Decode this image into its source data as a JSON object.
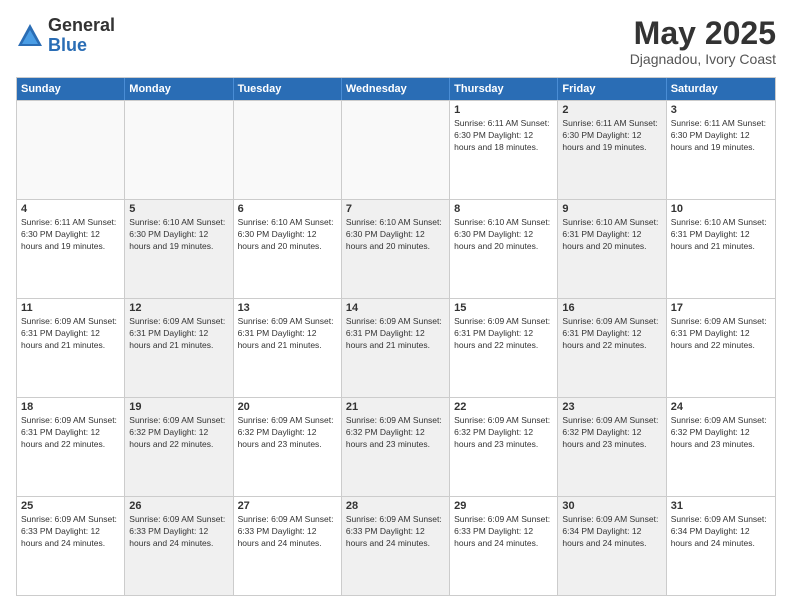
{
  "logo": {
    "general": "General",
    "blue": "Blue"
  },
  "title": "May 2025",
  "location": "Djagnadou, Ivory Coast",
  "days_header": [
    "Sunday",
    "Monday",
    "Tuesday",
    "Wednesday",
    "Thursday",
    "Friday",
    "Saturday"
  ],
  "weeks": [
    [
      {
        "day": "",
        "info": "",
        "empty": true
      },
      {
        "day": "",
        "info": "",
        "empty": true
      },
      {
        "day": "",
        "info": "",
        "empty": true
      },
      {
        "day": "",
        "info": "",
        "empty": true
      },
      {
        "day": "1",
        "info": "Sunrise: 6:11 AM\nSunset: 6:30 PM\nDaylight: 12 hours\nand 18 minutes.",
        "empty": false,
        "shaded": false
      },
      {
        "day": "2",
        "info": "Sunrise: 6:11 AM\nSunset: 6:30 PM\nDaylight: 12 hours\nand 19 minutes.",
        "empty": false,
        "shaded": true
      },
      {
        "day": "3",
        "info": "Sunrise: 6:11 AM\nSunset: 6:30 PM\nDaylight: 12 hours\nand 19 minutes.",
        "empty": false,
        "shaded": false
      }
    ],
    [
      {
        "day": "4",
        "info": "Sunrise: 6:11 AM\nSunset: 6:30 PM\nDaylight: 12 hours\nand 19 minutes.",
        "empty": false,
        "shaded": false
      },
      {
        "day": "5",
        "info": "Sunrise: 6:10 AM\nSunset: 6:30 PM\nDaylight: 12 hours\nand 19 minutes.",
        "empty": false,
        "shaded": true
      },
      {
        "day": "6",
        "info": "Sunrise: 6:10 AM\nSunset: 6:30 PM\nDaylight: 12 hours\nand 20 minutes.",
        "empty": false,
        "shaded": false
      },
      {
        "day": "7",
        "info": "Sunrise: 6:10 AM\nSunset: 6:30 PM\nDaylight: 12 hours\nand 20 minutes.",
        "empty": false,
        "shaded": true
      },
      {
        "day": "8",
        "info": "Sunrise: 6:10 AM\nSunset: 6:30 PM\nDaylight: 12 hours\nand 20 minutes.",
        "empty": false,
        "shaded": false
      },
      {
        "day": "9",
        "info": "Sunrise: 6:10 AM\nSunset: 6:31 PM\nDaylight: 12 hours\nand 20 minutes.",
        "empty": false,
        "shaded": true
      },
      {
        "day": "10",
        "info": "Sunrise: 6:10 AM\nSunset: 6:31 PM\nDaylight: 12 hours\nand 21 minutes.",
        "empty": false,
        "shaded": false
      }
    ],
    [
      {
        "day": "11",
        "info": "Sunrise: 6:09 AM\nSunset: 6:31 PM\nDaylight: 12 hours\nand 21 minutes.",
        "empty": false,
        "shaded": false
      },
      {
        "day": "12",
        "info": "Sunrise: 6:09 AM\nSunset: 6:31 PM\nDaylight: 12 hours\nand 21 minutes.",
        "empty": false,
        "shaded": true
      },
      {
        "day": "13",
        "info": "Sunrise: 6:09 AM\nSunset: 6:31 PM\nDaylight: 12 hours\nand 21 minutes.",
        "empty": false,
        "shaded": false
      },
      {
        "day": "14",
        "info": "Sunrise: 6:09 AM\nSunset: 6:31 PM\nDaylight: 12 hours\nand 21 minutes.",
        "empty": false,
        "shaded": true
      },
      {
        "day": "15",
        "info": "Sunrise: 6:09 AM\nSunset: 6:31 PM\nDaylight: 12 hours\nand 22 minutes.",
        "empty": false,
        "shaded": false
      },
      {
        "day": "16",
        "info": "Sunrise: 6:09 AM\nSunset: 6:31 PM\nDaylight: 12 hours\nand 22 minutes.",
        "empty": false,
        "shaded": true
      },
      {
        "day": "17",
        "info": "Sunrise: 6:09 AM\nSunset: 6:31 PM\nDaylight: 12 hours\nand 22 minutes.",
        "empty": false,
        "shaded": false
      }
    ],
    [
      {
        "day": "18",
        "info": "Sunrise: 6:09 AM\nSunset: 6:31 PM\nDaylight: 12 hours\nand 22 minutes.",
        "empty": false,
        "shaded": false
      },
      {
        "day": "19",
        "info": "Sunrise: 6:09 AM\nSunset: 6:32 PM\nDaylight: 12 hours\nand 22 minutes.",
        "empty": false,
        "shaded": true
      },
      {
        "day": "20",
        "info": "Sunrise: 6:09 AM\nSunset: 6:32 PM\nDaylight: 12 hours\nand 23 minutes.",
        "empty": false,
        "shaded": false
      },
      {
        "day": "21",
        "info": "Sunrise: 6:09 AM\nSunset: 6:32 PM\nDaylight: 12 hours\nand 23 minutes.",
        "empty": false,
        "shaded": true
      },
      {
        "day": "22",
        "info": "Sunrise: 6:09 AM\nSunset: 6:32 PM\nDaylight: 12 hours\nand 23 minutes.",
        "empty": false,
        "shaded": false
      },
      {
        "day": "23",
        "info": "Sunrise: 6:09 AM\nSunset: 6:32 PM\nDaylight: 12 hours\nand 23 minutes.",
        "empty": false,
        "shaded": true
      },
      {
        "day": "24",
        "info": "Sunrise: 6:09 AM\nSunset: 6:32 PM\nDaylight: 12 hours\nand 23 minutes.",
        "empty": false,
        "shaded": false
      }
    ],
    [
      {
        "day": "25",
        "info": "Sunrise: 6:09 AM\nSunset: 6:33 PM\nDaylight: 12 hours\nand 24 minutes.",
        "empty": false,
        "shaded": false
      },
      {
        "day": "26",
        "info": "Sunrise: 6:09 AM\nSunset: 6:33 PM\nDaylight: 12 hours\nand 24 minutes.",
        "empty": false,
        "shaded": true
      },
      {
        "day": "27",
        "info": "Sunrise: 6:09 AM\nSunset: 6:33 PM\nDaylight: 12 hours\nand 24 minutes.",
        "empty": false,
        "shaded": false
      },
      {
        "day": "28",
        "info": "Sunrise: 6:09 AM\nSunset: 6:33 PM\nDaylight: 12 hours\nand 24 minutes.",
        "empty": false,
        "shaded": true
      },
      {
        "day": "29",
        "info": "Sunrise: 6:09 AM\nSunset: 6:33 PM\nDaylight: 12 hours\nand 24 minutes.",
        "empty": false,
        "shaded": false
      },
      {
        "day": "30",
        "info": "Sunrise: 6:09 AM\nSunset: 6:34 PM\nDaylight: 12 hours\nand 24 minutes.",
        "empty": false,
        "shaded": true
      },
      {
        "day": "31",
        "info": "Sunrise: 6:09 AM\nSunset: 6:34 PM\nDaylight: 12 hours\nand 24 minutes.",
        "empty": false,
        "shaded": false
      }
    ]
  ]
}
